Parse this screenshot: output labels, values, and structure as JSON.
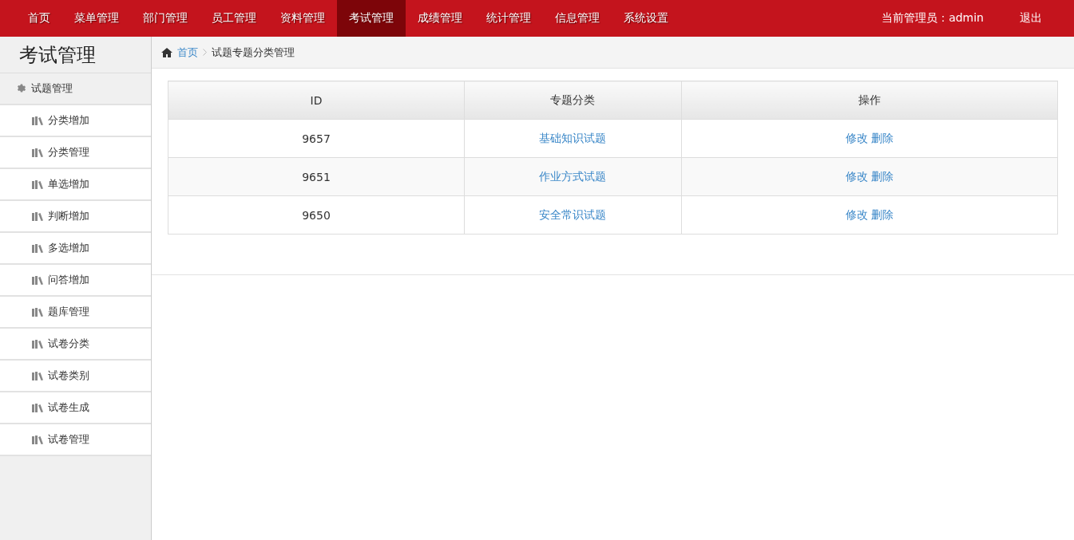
{
  "nav": {
    "items": [
      {
        "label": "首页",
        "selected": false
      },
      {
        "label": "菜单管理",
        "selected": false
      },
      {
        "label": "部门管理",
        "selected": false
      },
      {
        "label": "员工管理",
        "selected": false
      },
      {
        "label": "资料管理",
        "selected": false
      },
      {
        "label": "考试管理",
        "selected": true
      },
      {
        "label": "成绩管理",
        "selected": false
      },
      {
        "label": "统计管理",
        "selected": false
      },
      {
        "label": "信息管理",
        "selected": false
      },
      {
        "label": "系统设置",
        "selected": false
      }
    ],
    "user": "当前管理员：admin",
    "logout": "退出"
  },
  "sidebar": {
    "title": "考试管理",
    "section": "试题管理",
    "items": [
      "分类增加",
      "分类管理",
      "单选增加",
      "判断增加",
      "多选增加",
      "问答增加",
      "题库管理",
      "试卷分类",
      "试卷类别",
      "试卷生成",
      "试卷管理"
    ]
  },
  "breadcrumb": {
    "home": "首页",
    "current": "试题专题分类管理"
  },
  "table": {
    "columns": [
      "ID",
      "专题分类",
      "操作"
    ],
    "rows": [
      {
        "id": "9657",
        "category": "基础知识试题",
        "actions": [
          "修改",
          "删除"
        ]
      },
      {
        "id": "9651",
        "category": "作业方式试题",
        "actions": [
          "修改",
          "删除"
        ]
      },
      {
        "id": "9650",
        "category": "安全常识试题",
        "actions": [
          "修改",
          "删除"
        ]
      }
    ]
  }
}
